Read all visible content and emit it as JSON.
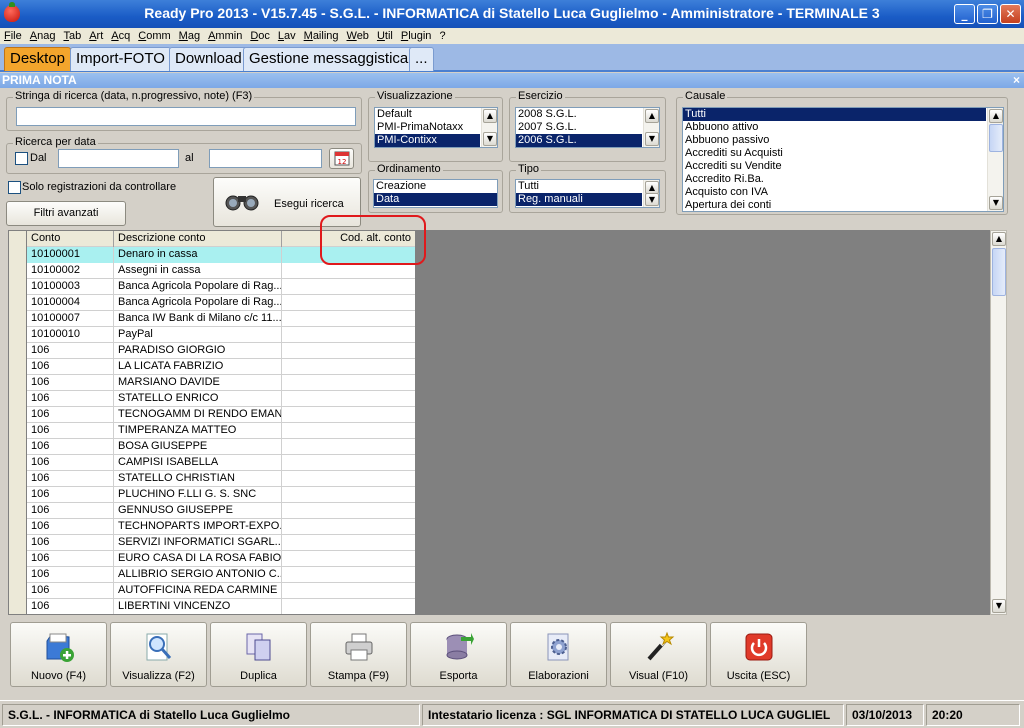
{
  "window": {
    "title": "Ready Pro 2013 - V15.7.45 - S.G.L. - INFORMATICA di Statello Luca Guglielmo - Amministratore - TERMINALE 3"
  },
  "menu": [
    "File",
    "Anag",
    "Tab",
    "Art",
    "Acq",
    "Comm",
    "Mag",
    "Ammin",
    "Doc",
    "Lav",
    "Mailing",
    "Web",
    "Util",
    "Plugin",
    "?"
  ],
  "tabs": [
    "Desktop",
    "Import-FOTO",
    "Download",
    "Gestione messaggistica",
    "..."
  ],
  "panel": {
    "title": "PRIMA NOTA",
    "close": "×"
  },
  "search": {
    "label": "Stringa di ricerca (data, n.progressivo, note) (F3)",
    "value": ""
  },
  "date_search": {
    "label": "Ricerca per data",
    "dal_label": "Dal",
    "al_label": "al",
    "dal_value": "",
    "al_value": "",
    "calendar_day": "12"
  },
  "solo_registrazioni_label": "Solo registrazioni da controllare",
  "filtri_avanzati_label": "Filtri avanzati",
  "esegui_ricerca_label": "Esegui ricerca",
  "visualizzazione": {
    "label": "Visualizzazione",
    "options": [
      "Default",
      "PMI-PrimaNotaxx",
      "PMI-Contixx"
    ],
    "selected_index": 2
  },
  "esercizio": {
    "label": "Esercizio",
    "options": [
      "2008 S.G.L.",
      "2007 S.G.L.",
      "2006 S.G.L."
    ],
    "selected_index": 2
  },
  "ordinamento": {
    "label": "Ordinamento",
    "options": [
      "Creazione",
      "Data"
    ],
    "selected_index": 1
  },
  "tipo": {
    "label": "Tipo",
    "options": [
      "Tutti",
      "Reg. manuali"
    ],
    "selected_index": 1
  },
  "causale": {
    "label": "Causale",
    "options": [
      "Tutti",
      "Abbuono attivo",
      "Abbuono passivo",
      "Accrediti su Acquisti",
      "Accrediti su Vendite",
      "Accredito Ri.Ba.",
      "Acquisto con IVA",
      "Apertura dei conti"
    ],
    "selected_index": 0
  },
  "grid": {
    "columns": [
      "Conto",
      "Descrizione conto",
      "Cod. alt. conto"
    ],
    "rows": [
      [
        "10100001",
        "Denaro in cassa",
        ""
      ],
      [
        "10100002",
        "Assegni in cassa",
        ""
      ],
      [
        "10100003",
        "Banca Agricola Popolare di Rag...",
        ""
      ],
      [
        "10100004",
        "Banca Agricola Popolare di Rag...",
        ""
      ],
      [
        "10100007",
        "Banca IW Bank di Milano c/c 11...",
        ""
      ],
      [
        "10100010",
        "PayPal",
        ""
      ],
      [
        "106",
        "PARADISO GIORGIO",
        ""
      ],
      [
        "106",
        "LA LICATA FABRIZIO",
        ""
      ],
      [
        "106",
        "MARSIANO DAVIDE",
        ""
      ],
      [
        "106",
        "STATELLO ENRICO",
        ""
      ],
      [
        "106",
        "TECNOGAMM DI RENDO EMAN...",
        ""
      ],
      [
        "106",
        "TIMPERANZA MATTEO",
        ""
      ],
      [
        "106",
        "BOSA GIUSEPPE",
        ""
      ],
      [
        "106",
        "CAMPISI ISABELLA",
        ""
      ],
      [
        "106",
        "STATELLO CHRISTIAN",
        ""
      ],
      [
        "106",
        "PLUCHINO F.LLI G. S. SNC",
        ""
      ],
      [
        "106",
        "GENNUSO GIUSEPPE",
        ""
      ],
      [
        "106",
        "TECHNOPARTS IMPORT-EXPO...",
        ""
      ],
      [
        "106",
        "SERVIZI INFORMATICI SGARL...",
        ""
      ],
      [
        "106",
        "EURO CASA DI LA ROSA FABIO",
        ""
      ],
      [
        "106",
        "ALLIBRIO SERGIO ANTONIO C...",
        ""
      ],
      [
        "106",
        "AUTOFFICINA REDA CARMINE",
        ""
      ],
      [
        "106",
        "LIBERTINI VINCENZO",
        ""
      ]
    ],
    "selected_row": 0
  },
  "toolbar": [
    {
      "label": "Nuovo (F4)",
      "icon": "new-document-icon"
    },
    {
      "label": "Visualizza (F2)",
      "icon": "magnifier-icon"
    },
    {
      "label": "Duplica",
      "icon": "duplicate-icon"
    },
    {
      "label": "Stampa (F9)",
      "icon": "printer-icon"
    },
    {
      "label": "Esporta",
      "icon": "export-database-icon"
    },
    {
      "label": "Elaborazioni",
      "icon": "gear-document-icon"
    },
    {
      "label": "Visual (F10)",
      "icon": "magic-wand-icon"
    },
    {
      "label": "Uscita (ESC)",
      "icon": "power-icon"
    }
  ],
  "status": {
    "company": "S.G.L. - INFORMATICA di Statello Luca Guglielmo",
    "license": "Intestatario licenza : SGL  INFORMATICA DI STATELLO LUCA GUGLIEL",
    "date": "03/10/2013",
    "time": "20:20"
  },
  "colors": {
    "title_bar": "#1a5cc6",
    "selection": "#0a246a",
    "active_tab": "#f3a52c",
    "grid_selected_row": "#a9f0f0",
    "highlight": "#e0191c"
  }
}
